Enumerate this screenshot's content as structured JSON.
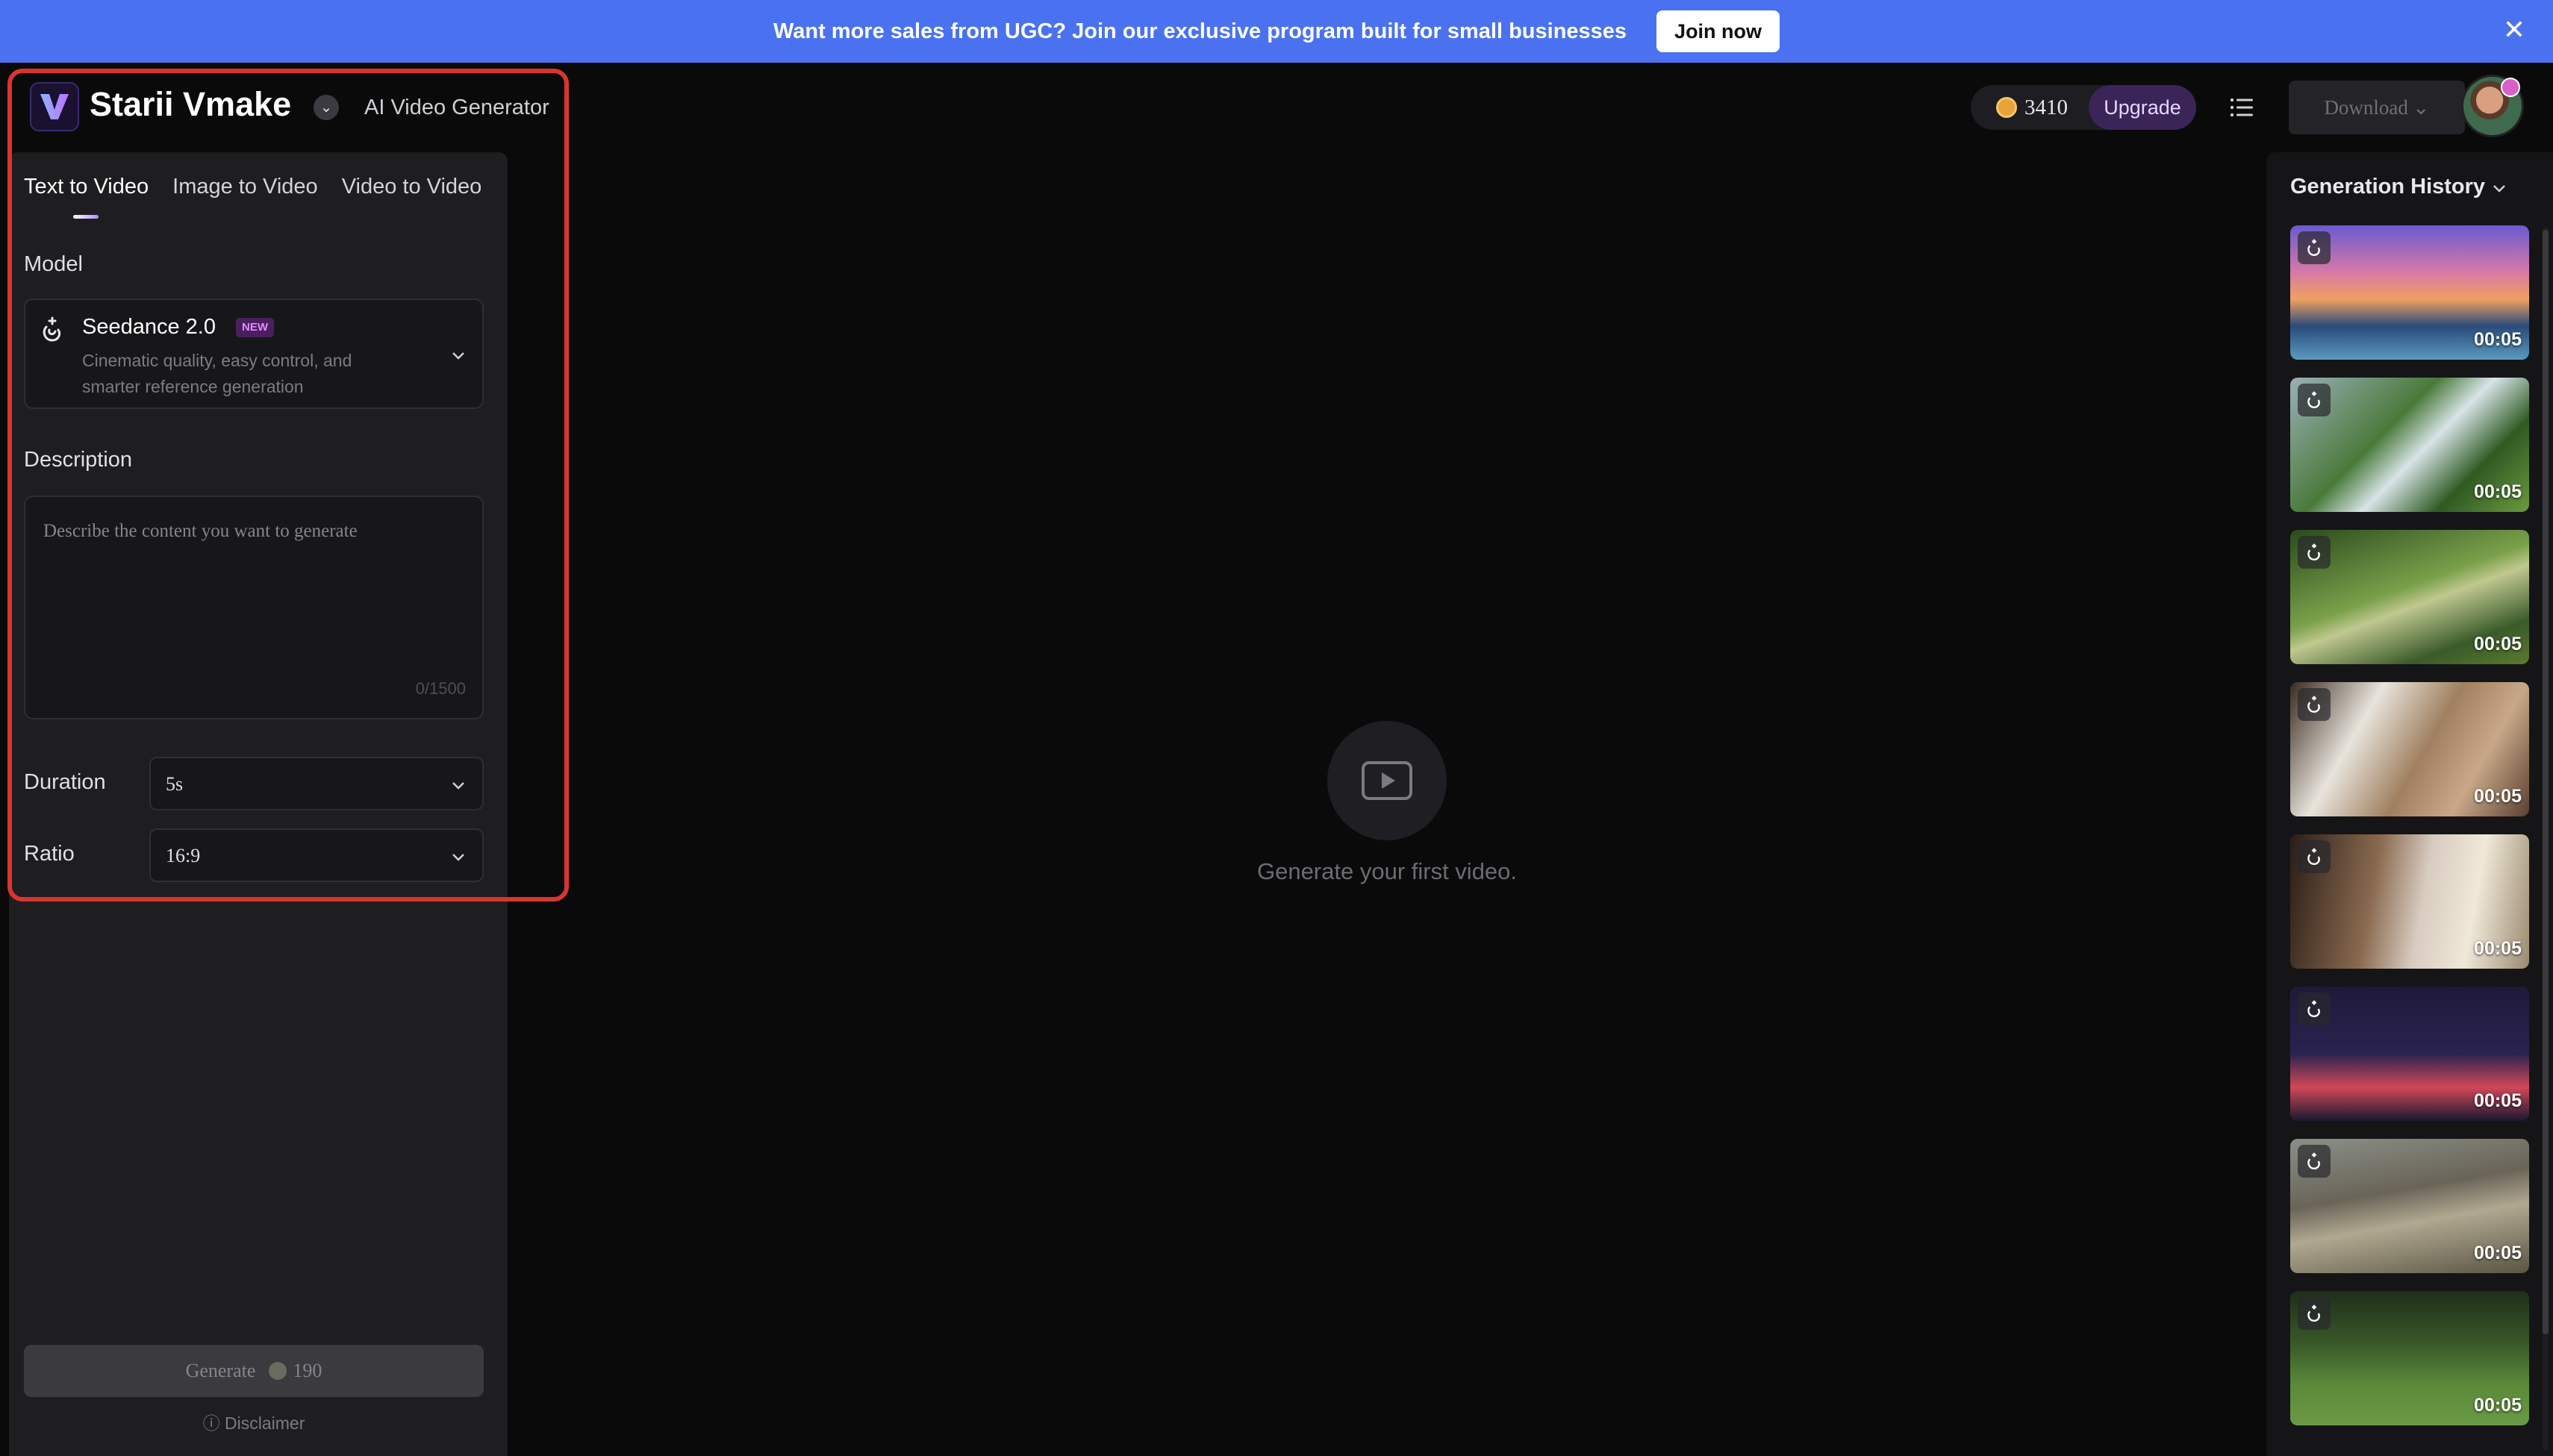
{
  "banner": {
    "text": "Want more sales from UGC? Join our exclusive program built for small businesses",
    "button": "Join now"
  },
  "header": {
    "brand": "Starii Vmake",
    "subtitle": "AI Video Generator",
    "credits": "3410",
    "upgrade": "Upgrade",
    "download": "Download"
  },
  "tabs": [
    "Text to Video",
    "Image to Video",
    "Video to Video"
  ],
  "form": {
    "model_label": "Model",
    "model_name": "Seedance 2.0",
    "model_badge": "NEW",
    "model_desc": "Cinematic quality, easy control, and smarter reference generation",
    "description_label": "Description",
    "description_placeholder": "Describe the content you want to generate",
    "description_count": "0/1500",
    "duration_label": "Duration",
    "duration_value": "5s",
    "ratio_label": "Ratio",
    "ratio_value": "16:9",
    "generate_label": "Generate",
    "generate_cost": "190",
    "disclaimer": "Disclaimer"
  },
  "center": {
    "empty_text": "Generate your first video."
  },
  "history": {
    "title": "Generation History",
    "items": [
      {
        "duration": "00:05"
      },
      {
        "duration": "00:05"
      },
      {
        "duration": "00:05"
      },
      {
        "duration": "00:05"
      },
      {
        "duration": "00:05"
      },
      {
        "duration": "00:05"
      },
      {
        "duration": "00:05"
      },
      {
        "duration": "00:05"
      }
    ]
  },
  "colors": {
    "banner": "#4a72f0",
    "highlight": "#d9352e",
    "upgrade_bg": "#3a2458"
  }
}
